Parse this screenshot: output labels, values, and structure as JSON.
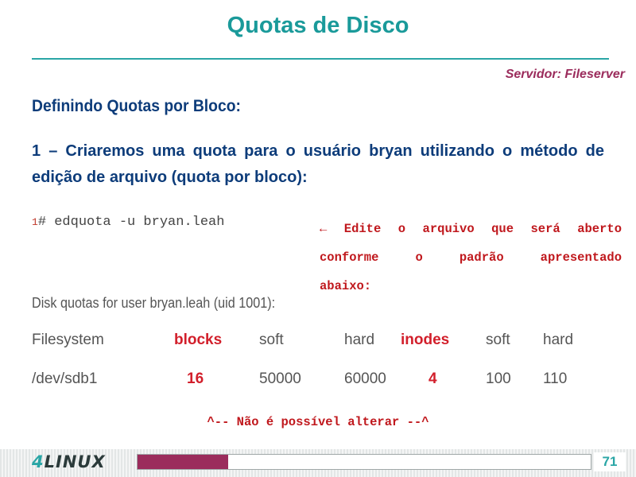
{
  "slide": {
    "title": "Quotas de Disco",
    "server": "Servidor: Fileserver",
    "subheading": "Definindo Quotas por Bloco:",
    "paragraph": "1 – Criaremos uma quota para o usuário bryan utilizando o método de edição de arquivo (quota por bloco):"
  },
  "command": {
    "line_number": "1",
    "text": "# edquota -u bryan.leah"
  },
  "note": {
    "line1": "← Edite o arquivo que será aberto",
    "line2": "conforme o padrão apresentado",
    "line3": "abaixo:"
  },
  "quota_table": {
    "caption": "Disk quotas for user bryan.leah (uid 1001):",
    "headers": [
      "Filesystem",
      "blocks",
      "soft",
      "hard",
      "inodes",
      "soft",
      "hard"
    ],
    "row": [
      "/dev/sdb1",
      "16",
      "50000",
      "60000",
      "4",
      "100",
      "110"
    ]
  },
  "bottom_note": "^-- Não é possível alterar --^",
  "footer": {
    "logo_number": "4",
    "logo_text": "LINUX",
    "page_number": "71",
    "progress_fraction": 0.2
  },
  "colors": {
    "title": "#1a9a9a",
    "accent": "#9b2c5c",
    "heading": "#0d3c7a",
    "highlight": "#d21f2b"
  }
}
